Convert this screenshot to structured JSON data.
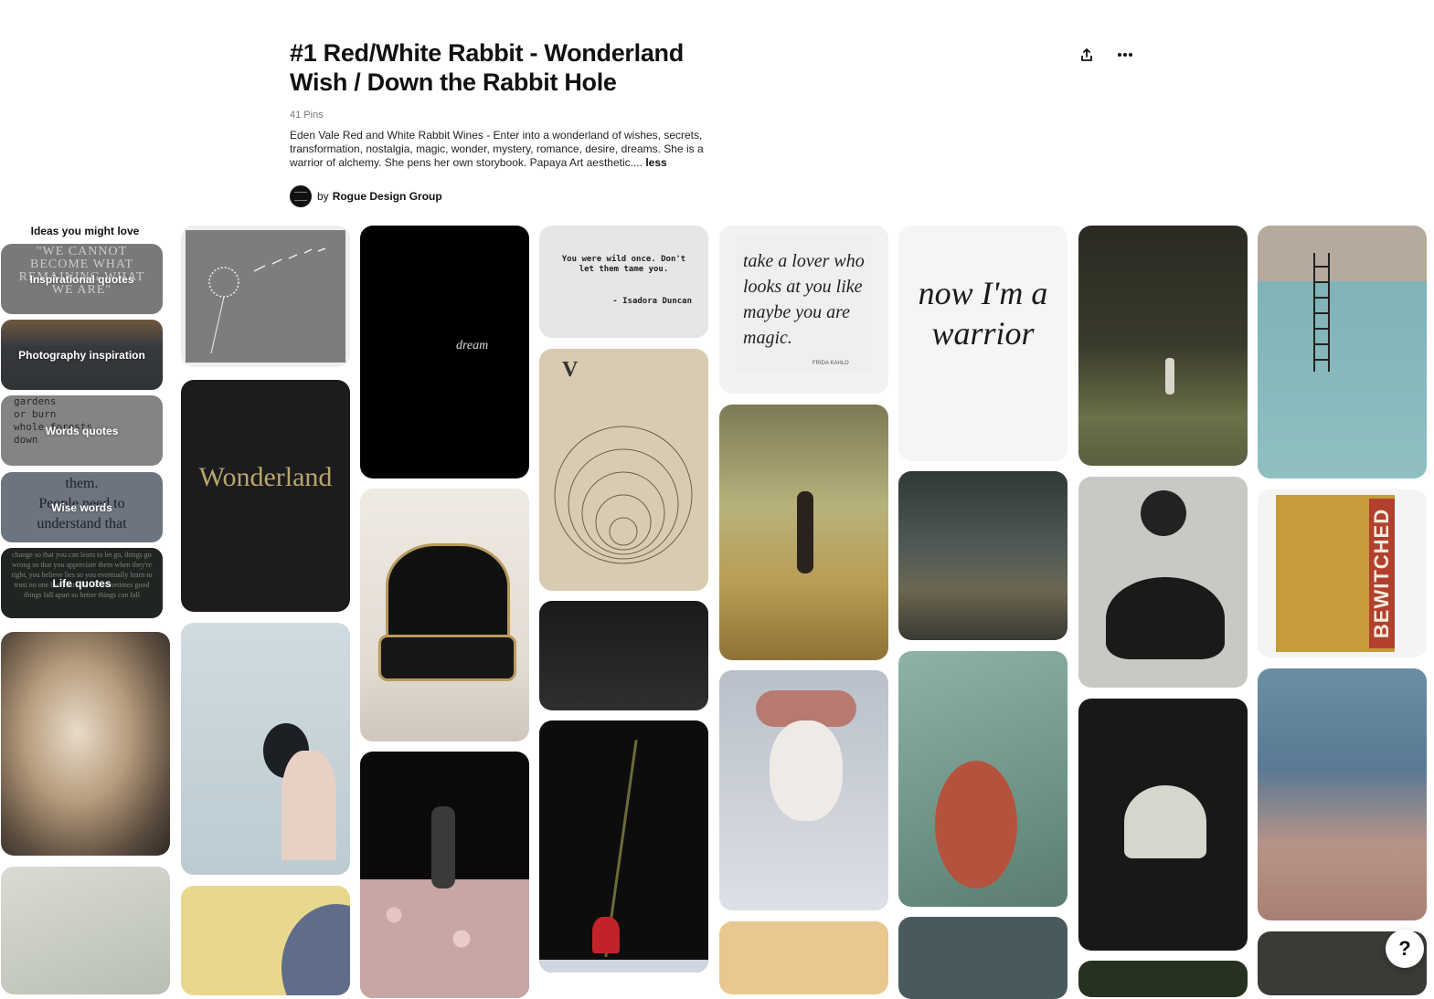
{
  "board": {
    "title": "#1 Red/White Rabbit - Wonderland Wish / Down the Rabbit Hole",
    "pin_count": "41 Pins",
    "description": "Eden Vale Red and White Rabbit Wines - Enter into a wonderland of wishes, secrets, transformation, nostalgia, magic, wonder, mystery, romance, desire, dreams. She is a warrior of alchemy. She pens her own storybook. Papaya Art aesthetic....",
    "less_label": "less",
    "by_label": "by",
    "owner": "Rogue Design Group"
  },
  "actions": {
    "share_icon": "share-icon",
    "more_icon": "more-icon"
  },
  "ideas": {
    "title": "Ideas you might love",
    "items": [
      {
        "label": "Inspirational quotes"
      },
      {
        "label": "Photography inspiration"
      },
      {
        "label": "Words quotes"
      },
      {
        "label": "Wise words"
      },
      {
        "label": "Life quotes"
      }
    ]
  },
  "pin_texts": {
    "dream": "dream",
    "wonderland": "Wonderland",
    "wild_quote": "You were wild once. Don't let them tame you.",
    "wild_author": "- Isadora Duncan",
    "lover_quote": "take a lover who looks at you like maybe you are magic.",
    "lover_author": "FRIDA KAHLO",
    "warrior_quote": "now I'm a warrior",
    "card_letter": "V",
    "bewitched": "BEWITCHED"
  },
  "help_label": "?"
}
